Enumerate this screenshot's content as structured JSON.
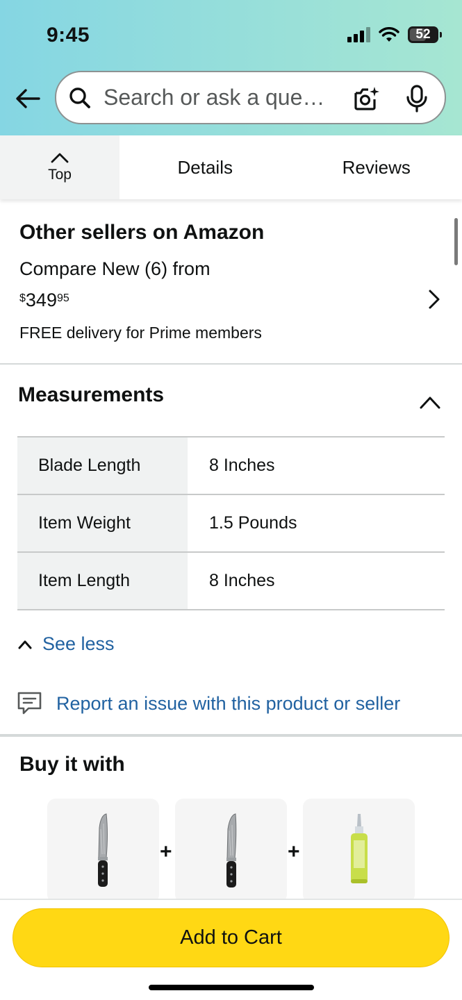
{
  "status_bar": {
    "time": "9:45",
    "battery": "52"
  },
  "search": {
    "placeholder": "Search or ask a question"
  },
  "tabs": {
    "top": "Top",
    "details": "Details",
    "reviews": "Reviews"
  },
  "sellers": {
    "title": "Other sellers on Amazon",
    "compare": "Compare New (6) from",
    "price_symbol": "$",
    "price_whole": "349",
    "price_fraction": "95",
    "delivery": "FREE delivery for Prime members"
  },
  "measurements": {
    "title": "Measurements",
    "rows": [
      {
        "label": "Blade Length",
        "value": "8 Inches"
      },
      {
        "label": "Item Weight",
        "value": "1.5 Pounds"
      },
      {
        "label": "Item Length",
        "value": "8 Inches"
      }
    ],
    "see_less": "See less"
  },
  "report": {
    "text": "Report an issue with this product or seller"
  },
  "buy_with": {
    "title": "Buy it with",
    "plus": "+"
  },
  "cart": {
    "label": "Add to Cart"
  },
  "colors": {
    "link": "#2162a1",
    "cart_button": "#ffd814",
    "header_start": "#85d6e3",
    "header_end": "#a6e6d2"
  }
}
